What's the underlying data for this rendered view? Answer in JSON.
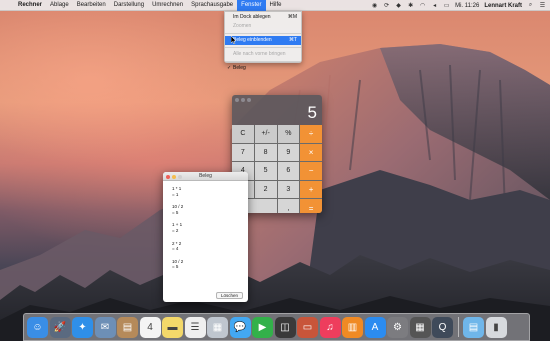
{
  "menubar": {
    "apple": "",
    "items": [
      "Rechner",
      "Ablage",
      "Bearbeiten",
      "Darstellung",
      "Umrechnen",
      "Sprachausgabe",
      "Fenster",
      "Hilfe"
    ],
    "active_index": 6,
    "clock": "Mi. 11:26",
    "user": "Lennart Kraft"
  },
  "window_menu": {
    "items": [
      {
        "label": "Im Dock ablegen",
        "shortcut": "⌘M",
        "disabled": false
      },
      {
        "label": "Zoomen",
        "shortcut": "",
        "disabled": true
      },
      {
        "label": "Beleg einblenden",
        "shortcut": "⌘T",
        "disabled": false,
        "highlight": true
      },
      {
        "label": "Alle nach vorne bringen",
        "shortcut": "",
        "disabled": true
      },
      {
        "label": "Beleg",
        "shortcut": "",
        "checked": true
      }
    ]
  },
  "calculator": {
    "display": "5",
    "keys": [
      {
        "label": "C",
        "kind": "fn"
      },
      {
        "label": "+/-",
        "kind": "fn"
      },
      {
        "label": "%",
        "kind": "fn"
      },
      {
        "label": "÷",
        "kind": "op"
      },
      {
        "label": "7",
        "kind": "num"
      },
      {
        "label": "8",
        "kind": "num"
      },
      {
        "label": "9",
        "kind": "num"
      },
      {
        "label": "×",
        "kind": "op"
      },
      {
        "label": "4",
        "kind": "num"
      },
      {
        "label": "5",
        "kind": "num"
      },
      {
        "label": "6",
        "kind": "num"
      },
      {
        "label": "−",
        "kind": "op"
      },
      {
        "label": "1",
        "kind": "num"
      },
      {
        "label": "2",
        "kind": "num"
      },
      {
        "label": "3",
        "kind": "num"
      },
      {
        "label": "+",
        "kind": "op"
      },
      {
        "label": "0",
        "kind": "zero"
      },
      {
        "label": ",",
        "kind": "num"
      },
      {
        "label": "=",
        "kind": "op"
      }
    ]
  },
  "beleg": {
    "title": "Beleg",
    "entries": [
      {
        "expr": "1 * 1",
        "result": "= 1"
      },
      {
        "expr": "10 / 2",
        "result": "= 5"
      },
      {
        "expr": "1 + 1",
        "result": "= 2"
      },
      {
        "expr": "2 * 2",
        "result": "= 4"
      },
      {
        "expr": "10 / 2",
        "result": "= 5"
      }
    ],
    "clear_label": "Löschen"
  },
  "dock": {
    "apps": [
      {
        "name": "finder-icon",
        "glyph": "☺",
        "color": "#3a8ee6"
      },
      {
        "name": "launchpad-icon",
        "glyph": "🚀",
        "color": "#5a6a80"
      },
      {
        "name": "safari-icon",
        "glyph": "✦",
        "color": "#2f8fe8"
      },
      {
        "name": "mail-stamp-icon",
        "glyph": "✉",
        "color": "#6d8fb6"
      },
      {
        "name": "contacts-icon",
        "glyph": "▤",
        "color": "#b58a5a"
      },
      {
        "name": "calendar-icon",
        "glyph": "4",
        "color": "#f4f4f4"
      },
      {
        "name": "notes-icon",
        "glyph": "▬",
        "color": "#f3d86a"
      },
      {
        "name": "reminders-icon",
        "glyph": "☰",
        "color": "#efefef"
      },
      {
        "name": "photos-icon",
        "glyph": "▦",
        "color": "#bfc6cf"
      },
      {
        "name": "messages-icon",
        "glyph": "💬",
        "color": "#43a8f2"
      },
      {
        "name": "facetime-icon",
        "glyph": "▶",
        "color": "#33b14a"
      },
      {
        "name": "photo-booth-icon",
        "glyph": "◫",
        "color": "#3a3a3a"
      },
      {
        "name": "presentation-icon",
        "glyph": "▭",
        "color": "#c8553a"
      },
      {
        "name": "music-icon",
        "glyph": "♫",
        "color": "#ee3d5d"
      },
      {
        "name": "books-icon",
        "glyph": "▥",
        "color": "#f08a24"
      },
      {
        "name": "app-store-icon",
        "glyph": "A",
        "color": "#2b8cf0"
      },
      {
        "name": "system-preferences-icon",
        "glyph": "⚙",
        "color": "#7c7c80"
      },
      {
        "name": "calculator-icon",
        "glyph": "▦",
        "color": "#555555"
      },
      {
        "name": "quicktime-icon",
        "glyph": "Q",
        "color": "#3f4a5a"
      }
    ],
    "right": [
      {
        "name": "downloads-folder-icon",
        "glyph": "▤",
        "color": "#6fb6ea"
      },
      {
        "name": "trash-icon",
        "glyph": "▮",
        "color": "#d7dade"
      }
    ]
  }
}
